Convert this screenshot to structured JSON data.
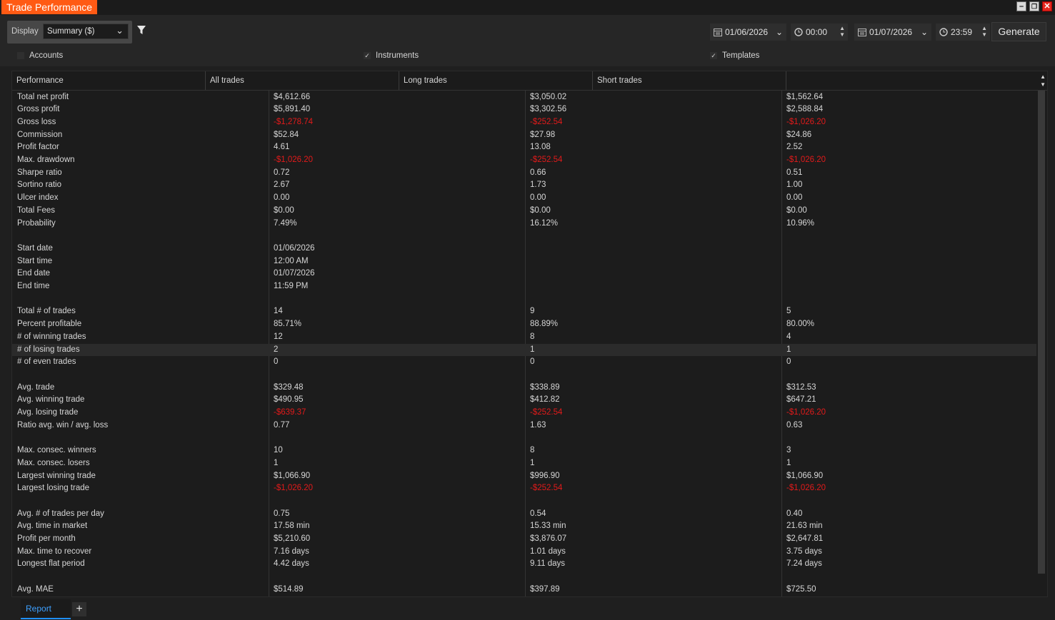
{
  "window": {
    "title": "Trade Performance"
  },
  "toolbar": {
    "display_label": "Display",
    "display_value": "Summary ($)",
    "date_from": "01/06/2026",
    "time_from": "00:00",
    "date_to": "01/07/2026",
    "time_to": "23:59",
    "generate_label": "Generate"
  },
  "filters": [
    {
      "label": "Accounts",
      "checked": false
    },
    {
      "label": "Instruments",
      "checked": true
    },
    {
      "label": "Templates",
      "checked": true
    }
  ],
  "grid": {
    "headers": [
      "Performance",
      "All trades",
      "Long trades",
      "Short trades"
    ],
    "rows": [
      [
        "Total net profit",
        "$4,612.66",
        "$3,050.02",
        "$1,562.64"
      ],
      [
        "Gross profit",
        "$5,891.40",
        "$3,302.56",
        "$2,588.84"
      ],
      [
        "Gross loss",
        "-$1,278.74",
        "-$252.54",
        "-$1,026.20"
      ],
      [
        "Commission",
        "$52.84",
        "$27.98",
        "$24.86"
      ],
      [
        "Profit factor",
        "4.61",
        "13.08",
        "2.52"
      ],
      [
        "Max. drawdown",
        "-$1,026.20",
        "-$252.54",
        "-$1,026.20"
      ],
      [
        "Sharpe ratio",
        "0.72",
        "0.66",
        "0.51"
      ],
      [
        "Sortino ratio",
        "2.67",
        "1.73",
        "1.00"
      ],
      [
        "Ulcer index",
        "0.00",
        "0.00",
        "0.00"
      ],
      [
        "Total Fees",
        "$0.00",
        "$0.00",
        "$0.00"
      ],
      [
        "Probability",
        "7.49%",
        "16.12%",
        "10.96%"
      ],
      [
        "",
        "",
        "",
        ""
      ],
      [
        "Start date",
        "01/06/2026",
        "",
        ""
      ],
      [
        "Start time",
        "12:00 AM",
        "",
        ""
      ],
      [
        "End date",
        "01/07/2026",
        "",
        ""
      ],
      [
        "End time",
        "11:59 PM",
        "",
        ""
      ],
      [
        "",
        "",
        "",
        ""
      ],
      [
        "Total # of trades",
        "14",
        "9",
        "5"
      ],
      [
        "Percent profitable",
        "85.71%",
        "88.89%",
        "80.00%"
      ],
      [
        "# of winning trades",
        "12",
        "8",
        "4"
      ],
      [
        "# of losing trades",
        "2",
        "1",
        "1"
      ],
      [
        "# of even trades",
        "0",
        "0",
        "0"
      ],
      [
        "",
        "",
        "",
        ""
      ],
      [
        "Avg. trade",
        "$329.48",
        "$338.89",
        "$312.53"
      ],
      [
        "Avg. winning trade",
        "$490.95",
        "$412.82",
        "$647.21"
      ],
      [
        "Avg. losing trade",
        "-$639.37",
        "-$252.54",
        "-$1,026.20"
      ],
      [
        "Ratio avg. win / avg. loss",
        "0.77",
        "1.63",
        "0.63"
      ],
      [
        "",
        "",
        "",
        ""
      ],
      [
        "Max. consec. winners",
        "10",
        "8",
        "3"
      ],
      [
        "Max. consec. losers",
        "1",
        "1",
        "1"
      ],
      [
        "Largest winning trade",
        "$1,066.90",
        "$996.90",
        "$1,066.90"
      ],
      [
        "Largest losing trade",
        "-$1,026.20",
        "-$252.54",
        "-$1,026.20"
      ],
      [
        "",
        "",
        "",
        ""
      ],
      [
        "Avg. # of trades per day",
        "0.75",
        "0.54",
        "0.40"
      ],
      [
        "Avg. time in market",
        "17.58 min",
        "15.33 min",
        "21.63 min"
      ],
      [
        "Profit per month",
        "$5,210.60",
        "$3,876.07",
        "$2,647.81"
      ],
      [
        "Max. time to recover",
        "7.16 days",
        "1.01 days",
        "3.75 days"
      ],
      [
        "Longest flat period",
        "4.42 days",
        "9.11 days",
        "7.24 days"
      ],
      [
        "",
        "",
        "",
        ""
      ],
      [
        "Avg. MAE",
        "$514.89",
        "$397.89",
        "$725.50"
      ]
    ],
    "highlighted_row": 20
  },
  "tabs": {
    "active": "Report",
    "add_label": "+"
  },
  "colors": {
    "accent": "#ff5a14",
    "negative": "#e21a1a",
    "tab_active": "#3ea0ff"
  }
}
